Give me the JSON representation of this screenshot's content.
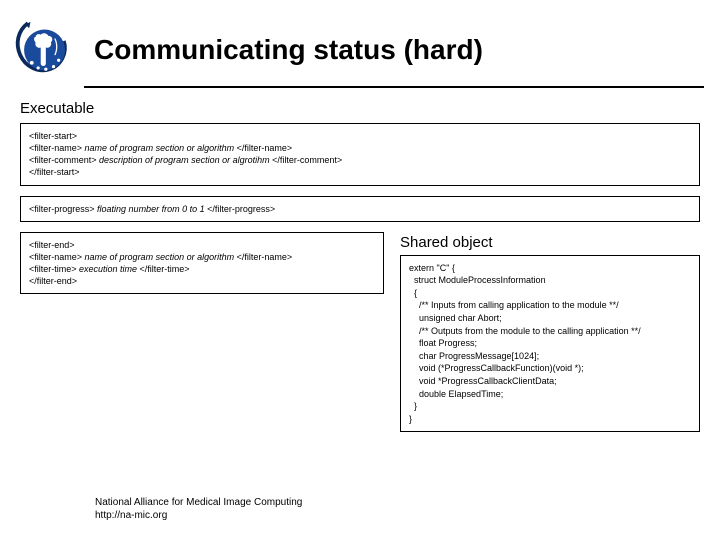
{
  "title": "Communicating status (hard)",
  "section1_label": "Executable",
  "box1": {
    "l1": "<filter-start>",
    "l2a": "<filter-name> ",
    "l2b": "name of program section or algorithm",
    "l2c": " </filter-name>",
    "l3a": "<filter-comment> ",
    "l3b": "description of program section or algrotihm",
    "l3c": " </filter-comment>",
    "l4": "</filter-start>"
  },
  "box2": {
    "a": "<filter-progress> ",
    "b": "floating number from 0 to 1",
    "c": " </filter-progress>"
  },
  "box3": {
    "l1": "<filter-end>",
    "l2a": "<filter-name> ",
    "l2b": "name of program section or algorithm",
    "l2c": " </filter-name>",
    "l3a": "<filter-time> ",
    "l3b": "execution time",
    "l3c": " </filter-time>",
    "l4": "</filter-end>"
  },
  "shared_label": "Shared object",
  "shared_code": "extern \"C\" {\n  struct ModuleProcessInformation\n  {\n    /** Inputs from calling application to the module **/\n    unsigned char Abort;\n    /** Outputs from the module to the calling application **/\n    float Progress;\n    char ProgressMessage[1024];\n    void (*ProgressCallbackFunction)(void *);\n    void *ProgressCallbackClientData;\n    double ElapsedTime;\n  }\n}",
  "footer_line1": "National Alliance for Medical Image Computing",
  "footer_line2": "http://na-mic.org"
}
